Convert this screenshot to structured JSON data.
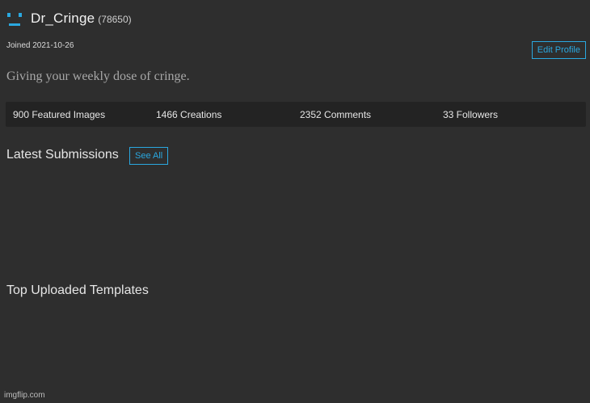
{
  "profile": {
    "username": "Dr_Cringe",
    "points": "(78650)",
    "joined": "Joined 2021-10-26",
    "bio": "Giving your weekly dose of cringe.",
    "edit_profile_label": "Edit Profile",
    "avatar_icon": "emoticon-face-icon",
    "accent_color": "#2aa8e0"
  },
  "stats": {
    "featured": "900 Featured Images",
    "creations": "1466 Creations",
    "comments": "2352 Comments",
    "followers": "33 Followers"
  },
  "sections": {
    "latest_title": "Latest Submissions",
    "see_all_label": "See All",
    "top_templates_title": "Top Uploaded Templates"
  },
  "watermark": "imgflip.com"
}
